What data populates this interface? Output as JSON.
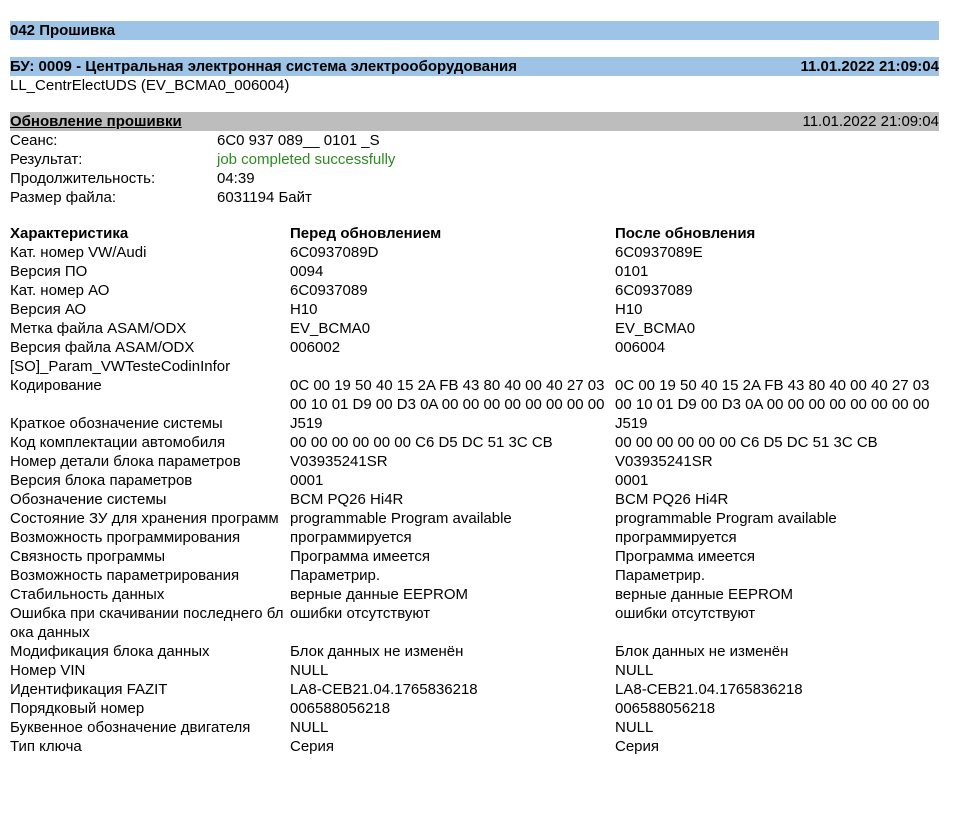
{
  "section_title": "042 Прошивка",
  "ecu": {
    "header": "БУ: 0009 - Центральная электронная система электрооборудования",
    "timestamp": "11.01.2022 21:09:04",
    "sub": "LL_CentrElectUDS (EV_BCMA0_006004)"
  },
  "update": {
    "title": "Обновление прошивки",
    "timestamp": "11.01.2022 21:09:04",
    "session_label": "Сеанс:",
    "session_value": "6C0 937 089__ 0101 _S",
    "result_label": "Результат:",
    "result_value": "job completed successfully",
    "duration_label": "Продолжительность:",
    "duration_value": "04:39",
    "filesize_label": "Размер файла:",
    "filesize_value": "6031194 Байт"
  },
  "table": {
    "headers": [
      "Характеристика",
      "Перед обновлением",
      "После обновления"
    ],
    "rows": [
      [
        "Кат. номер VW/Audi",
        "6C0937089D",
        "6C0937089E"
      ],
      [
        "Версия ПО",
        "0094",
        "0101"
      ],
      [
        "Кат. номер АО",
        "6C0937089",
        "6C0937089"
      ],
      [
        "Версия АО",
        "H10",
        "H10"
      ],
      [
        "Метка файла ASAM/ODX",
        "EV_BCMA0",
        "EV_BCMA0"
      ],
      [
        "Версия файла ASAM/ODX",
        "006002",
        "006004"
      ],
      [
        "[SO]_Param_VWTesteCodinInfor",
        "",
        ""
      ],
      [
        "Кодирование",
        "0C 00 19 50 40 15 2A FB 43 80 40 00 40 27 03 00 10 01 D9 00 D3 0A 00 00 00 00 00 00 00 00",
        "0C 00 19 50 40 15 2A FB 43 80 40 00 40 27 03 00 10 01 D9 00 D3 0A 00 00 00 00 00 00 00 00"
      ],
      [
        "Краткое обозначение системы",
        "J519",
        "J519"
      ],
      [
        "Код комплектации автомобиля",
        "00 00 00 00 00 00 C6 D5 DC 51 3C CB",
        "00 00 00 00 00 00 C6 D5 DC 51 3C CB"
      ],
      [
        "Номер детали блока параметров",
        "V03935241SR",
        "V03935241SR"
      ],
      [
        "Версия блока параметров",
        "0001",
        "0001"
      ],
      [
        "Обозначение системы",
        "BCM PQ26 Hi4R",
        "BCM PQ26 Hi4R"
      ],
      [
        "Состояние ЗУ для хранения программ",
        "programmable Program available",
        "programmable Program available"
      ],
      [
        "Возможность программирования",
        "программируется",
        "программируется"
      ],
      [
        "Связность программы",
        "Программа имеется",
        "Программа имеется"
      ],
      [
        "Возможность параметрирования",
        "Параметрир.",
        "Параметрир."
      ],
      [
        "Стабильность данных",
        "верные данные EEPROM",
        "верные данные EEPROM"
      ],
      [
        "Ошибка при скачивании последнего блока данных",
        "ошибки отсутствуют",
        "ошибки отсутствуют"
      ],
      [
        "Модификация блока данных",
        "Блок данных не изменён",
        "Блок данных не изменён"
      ],
      [
        "Номер VIN",
        "NULL",
        "NULL"
      ],
      [
        "Идентификация FAZIT",
        "LA8-CEB21.04.1765836218",
        "LA8-CEB21.04.1765836218"
      ],
      [
        "Порядковый номер",
        "006588056218",
        "006588056218"
      ],
      [
        "Буквенное обозначение двигателя",
        "NULL",
        "NULL"
      ],
      [
        "Тип ключа",
        "Серия",
        "Серия"
      ]
    ]
  }
}
